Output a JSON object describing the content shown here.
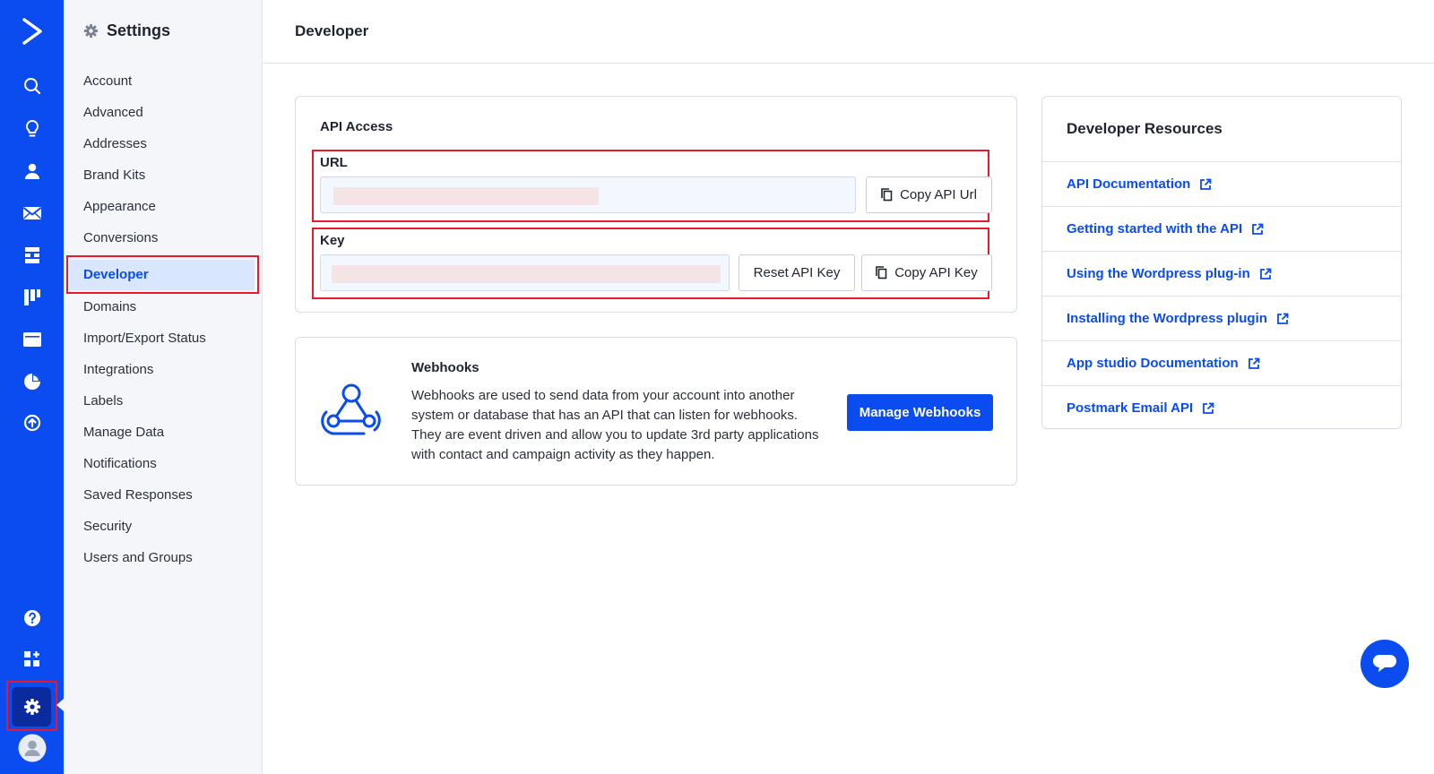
{
  "colors": {
    "brand": "#0a4cf0",
    "highlight": "#e8192c",
    "sidebar_bg": "#f4f6fa"
  },
  "rail": {
    "icons": [
      "logo-icon",
      "search-icon",
      "lightbulb-icon",
      "contacts-icon",
      "email-icon",
      "automations-icon",
      "deals-icon",
      "website-icon",
      "reports-icon",
      "upgrade-icon",
      "help-icon",
      "apps-icon",
      "settings-icon",
      "avatar-icon"
    ]
  },
  "sidebar": {
    "title": "Settings",
    "items": [
      {
        "label": "Account"
      },
      {
        "label": "Advanced"
      },
      {
        "label": "Addresses"
      },
      {
        "label": "Brand Kits"
      },
      {
        "label": "Appearance"
      },
      {
        "label": "Conversions"
      },
      {
        "label": "Developer",
        "active": true
      },
      {
        "label": "Domains"
      },
      {
        "label": "Import/Export Status"
      },
      {
        "label": "Integrations"
      },
      {
        "label": "Labels"
      },
      {
        "label": "Manage Data"
      },
      {
        "label": "Notifications"
      },
      {
        "label": "Saved Responses"
      },
      {
        "label": "Security"
      },
      {
        "label": "Users and Groups"
      }
    ]
  },
  "header": {
    "title": "Developer"
  },
  "api_access": {
    "title": "API Access",
    "url_label": "URL",
    "copy_url_label": "Copy API Url",
    "key_label": "Key",
    "reset_key_label": "Reset API Key",
    "copy_key_label": "Copy API Key"
  },
  "webhooks": {
    "title": "Webhooks",
    "description": "Webhooks are used to send data from your account into another system or database that has an API that can listen for webhooks. They are event driven and allow you to update 3rd party applications with contact and campaign activity as they happen.",
    "button_label": "Manage Webhooks"
  },
  "resources": {
    "title": "Developer Resources",
    "links": [
      {
        "label": "API Documentation"
      },
      {
        "label": "Getting started with the API"
      },
      {
        "label": "Using the Wordpress plug-in"
      },
      {
        "label": "Installing the Wordpress plugin"
      },
      {
        "label": "App studio Documentation"
      },
      {
        "label": "Postmark Email API"
      }
    ]
  }
}
